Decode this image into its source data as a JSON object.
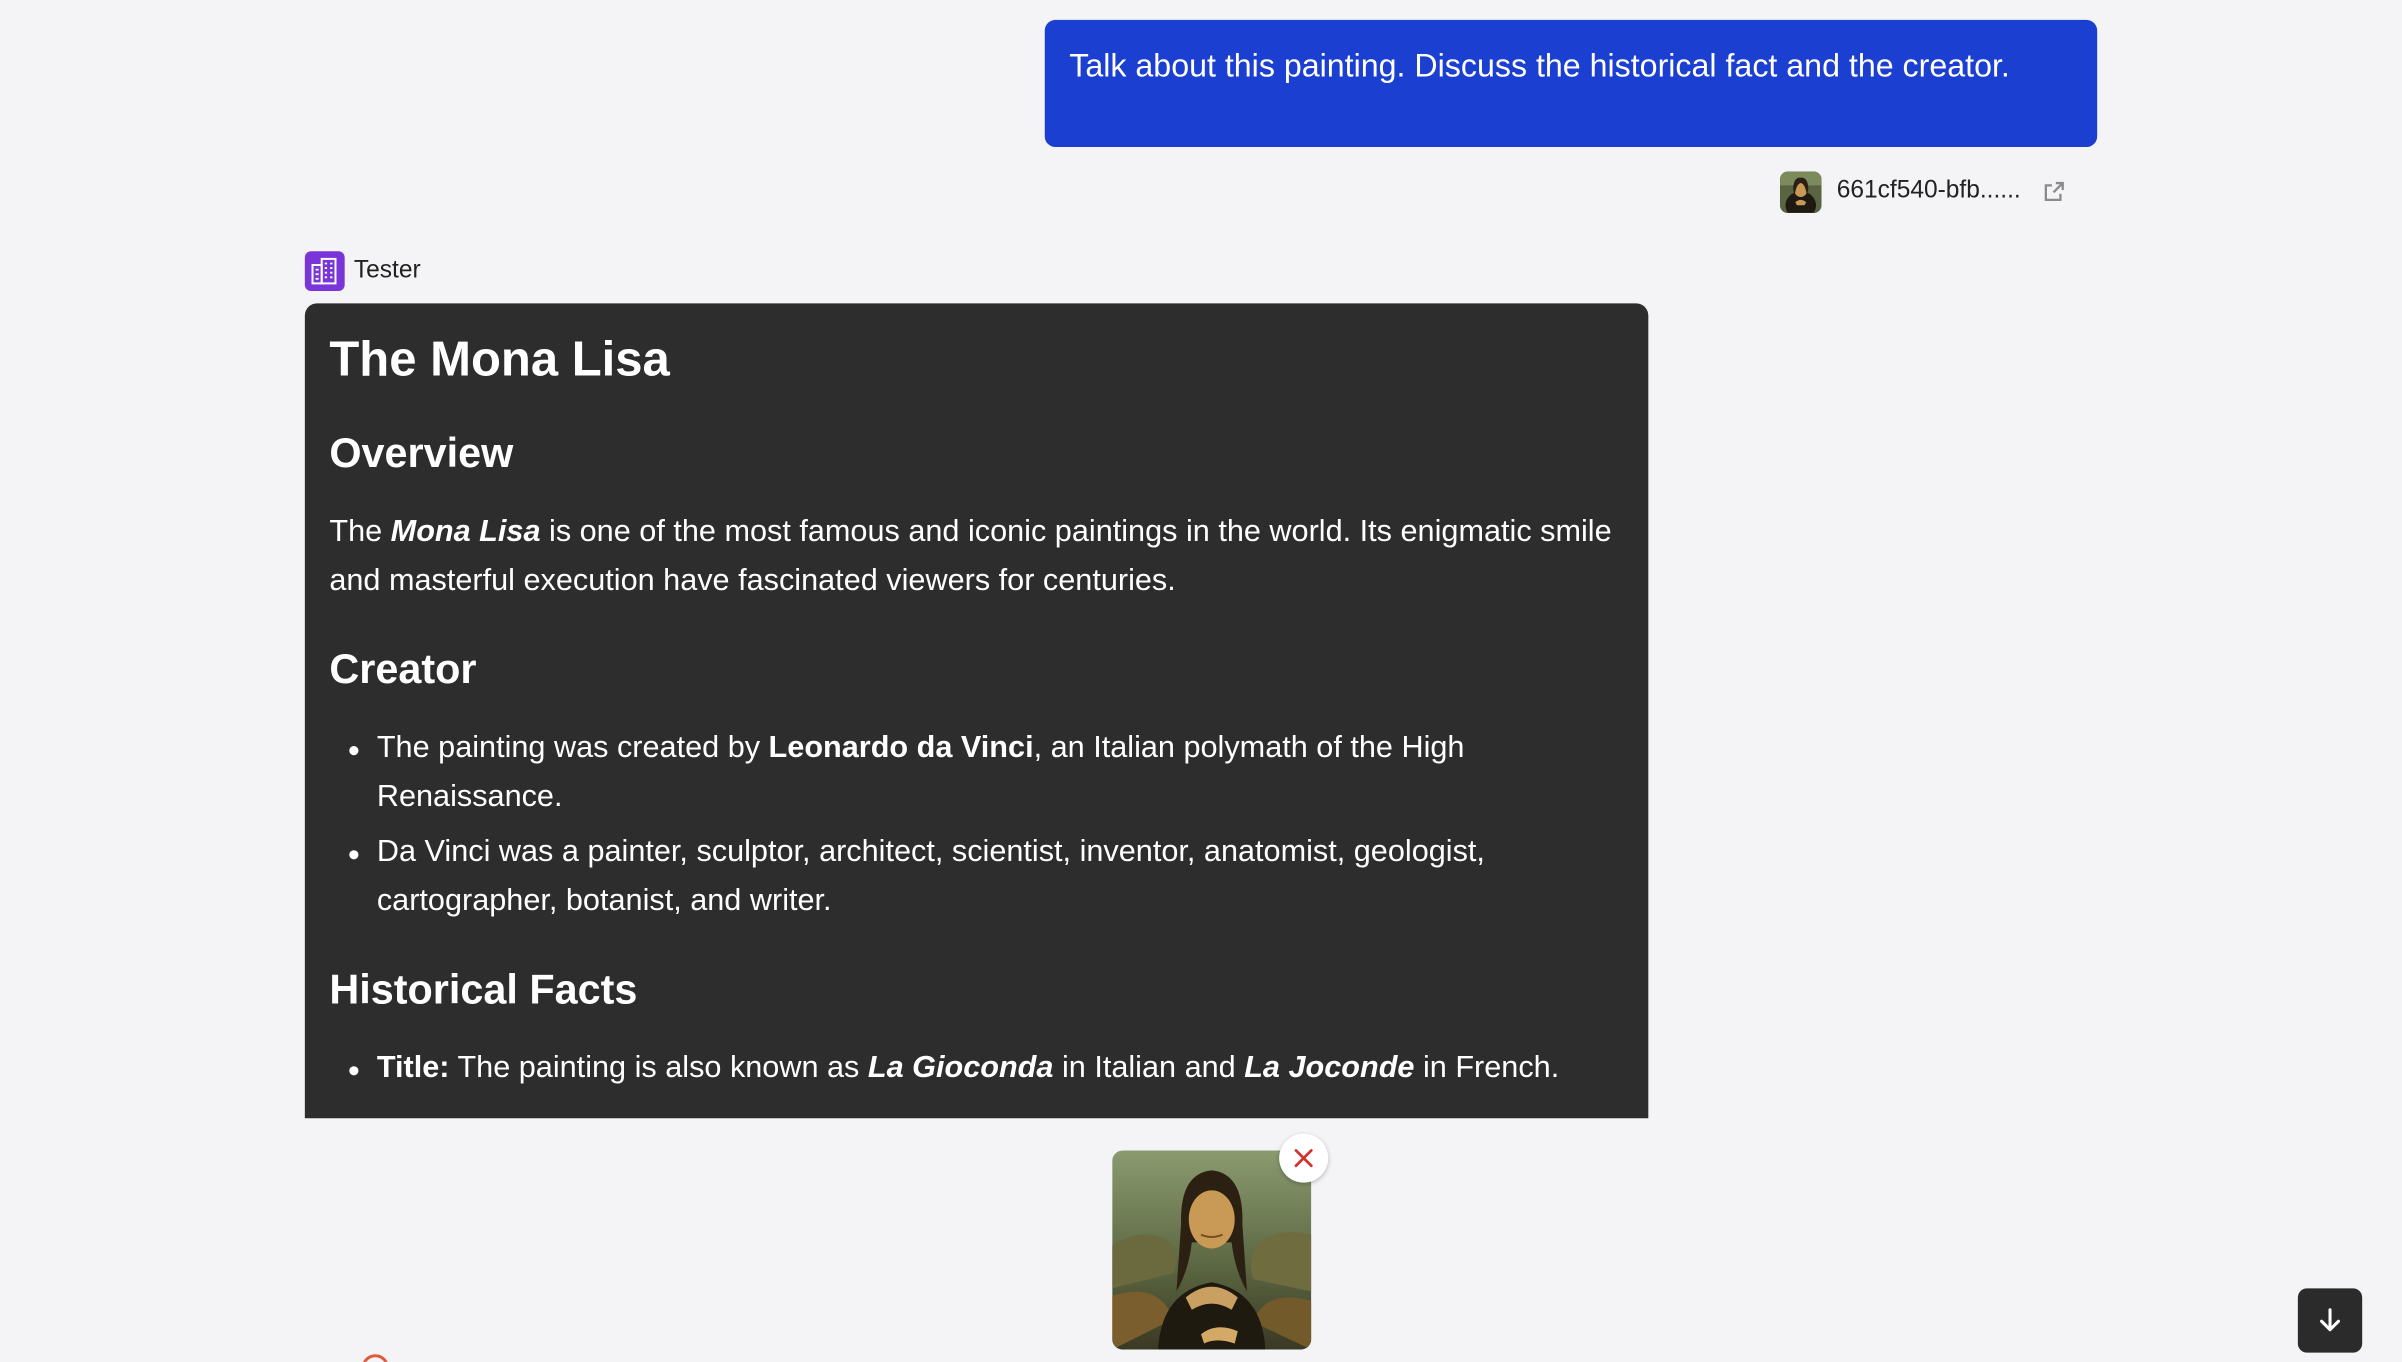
{
  "conversation": {
    "user_message": "Talk about this painting. Discuss the historical fact and the creator.",
    "attachment_name": "661cf540-bfb......",
    "attachment_thumbnail": "mona-lisa-thumbnail",
    "bot_name": "Tester",
    "bot_avatar_icon": "building-icon"
  },
  "reply": {
    "title": "The Mona Lisa",
    "overview_heading": "Overview",
    "overview": {
      "pre": "The ",
      "em": "Mona Lisa",
      "post": " is one of the most famous and iconic paintings in the world. Its enigmatic smile and masterful execution have fascinated viewers for centuries."
    },
    "creator_heading": "Creator",
    "creator_items": [
      {
        "pre": "The painting was created by ",
        "strong": "Leonardo da Vinci",
        "post": ", an Italian polymath of the High Renaissance."
      },
      {
        "text": "Da Vinci was a painter, sculptor, architect, scientist, inventor, anatomist, geologist, cartographer, botanist, and writer."
      }
    ],
    "historical_heading": "Historical Facts",
    "historical_items": [
      {
        "label": "Title:",
        "pre": " The painting is also known as ",
        "em1": "La Gioconda",
        "mid": " in Italian and ",
        "em2": "La Joconde",
        "post": " in French."
      }
    ]
  },
  "composer": {
    "preview_image": "mona-lisa-preview",
    "remove_icon": "close-icon",
    "scroll_icon": "arrow-down-icon"
  },
  "colors": {
    "user_bubble": "#1b3fd0",
    "reply_background": "#2d2d2d",
    "bot_avatar": "#7a35d8",
    "page_background": "#f4f4f6",
    "remove_icon": "#d0342c"
  }
}
